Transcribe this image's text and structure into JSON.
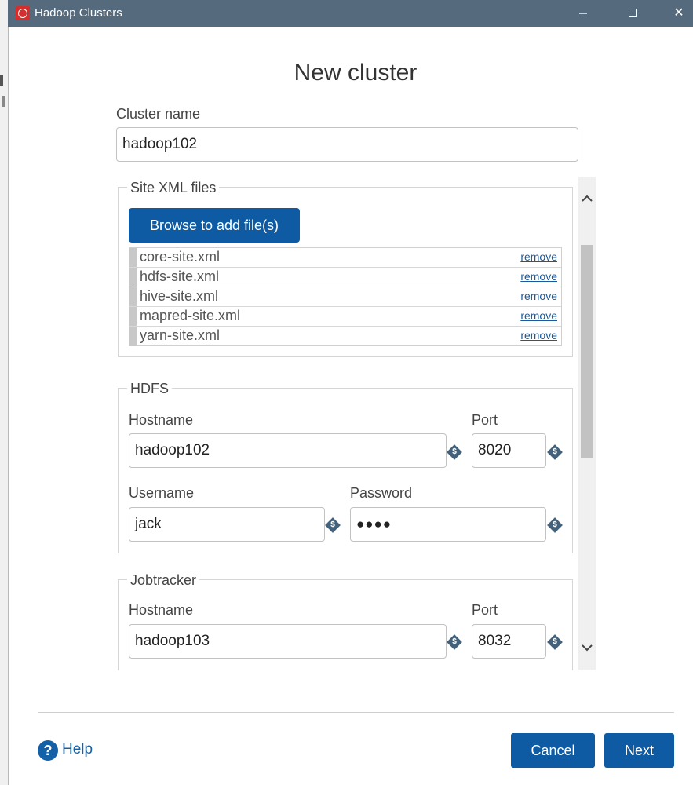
{
  "window": {
    "title": "Hadoop Clusters",
    "controls": {
      "minimize": "–",
      "maximize": "□",
      "close": "✕"
    }
  },
  "heading": "New cluster",
  "cluster_name": {
    "label": "Cluster name",
    "value": "hadoop102"
  },
  "site_xml": {
    "legend": "Site XML files",
    "browse_label": "Browse to add file(s)",
    "remove_label": "remove",
    "files": [
      "core-site.xml",
      "hdfs-site.xml",
      "hive-site.xml",
      "mapred-site.xml",
      "yarn-site.xml"
    ]
  },
  "hdfs": {
    "legend": "HDFS",
    "hostname_label": "Hostname",
    "hostname": "hadoop102",
    "port_label": "Port",
    "port": "8020",
    "username_label": "Username",
    "username": "jack",
    "password_label": "Password",
    "password_mask": "●●●●"
  },
  "jobtracker": {
    "legend": "Jobtracker",
    "hostname_label": "Hostname",
    "hostname": "hadoop103",
    "port_label": "Port",
    "port": "8032"
  },
  "variable_icon_glyph": "$",
  "footer": {
    "help_glyph": "?",
    "help_label": "Help",
    "cancel_label": "Cancel",
    "next_label": "Next"
  },
  "colors": {
    "titlebar": "#556b7d",
    "primary_button": "#0f5ba3",
    "link": "#1a5a9c",
    "variable_icon": "#43617b"
  }
}
